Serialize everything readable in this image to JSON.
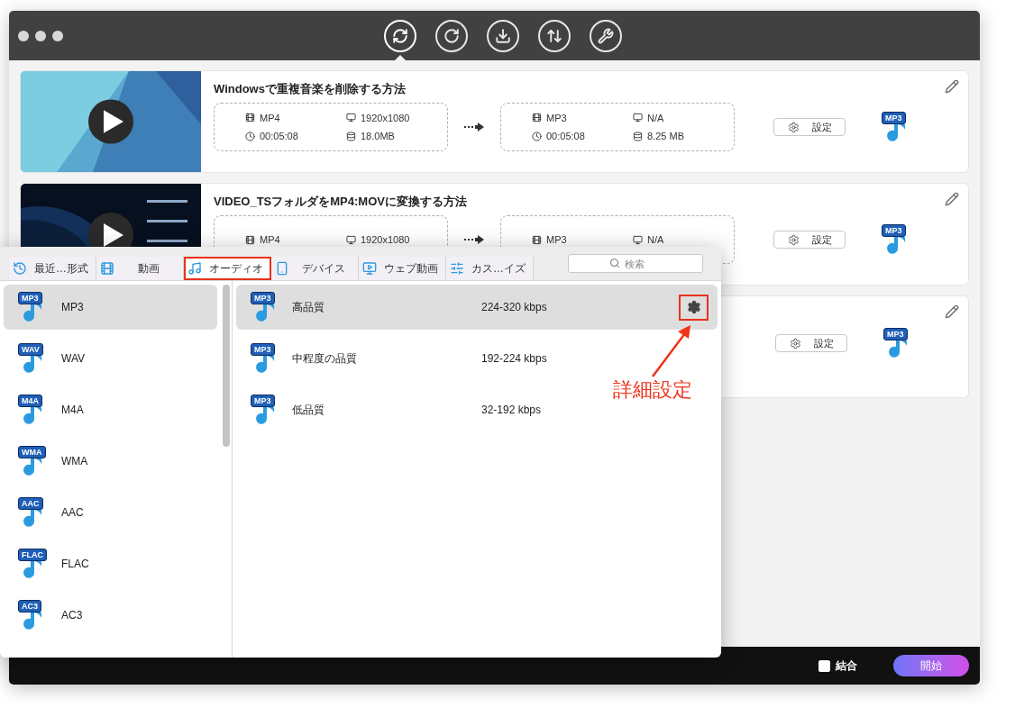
{
  "toolbar_buttons": [
    {
      "selected": true
    },
    {
      "selected": false
    },
    {
      "selected": false
    },
    {
      "selected": false
    },
    {
      "selected": false
    }
  ],
  "tasks": [
    {
      "title": "Windowsで重複音楽を削除する方法",
      "source": {
        "format": "MP4",
        "resolution": "1920x1080",
        "duration": "00:05:08",
        "size": "18.0MB"
      },
      "target": {
        "format": "MP3",
        "resolution": "N/A",
        "duration": "00:05:08",
        "size": "8.25 MB"
      },
      "settings_label": "設定",
      "output_badge": "MP3"
    },
    {
      "title": "VIDEO_TSフォルダをMP4:MOVに変換する方法",
      "source": {
        "format": "MP4",
        "resolution": "1920x1080"
      },
      "target": {
        "format": "MP3",
        "resolution": "N/A"
      },
      "settings_label": "設定",
      "output_badge": "MP3"
    },
    {
      "settings_label": "設定",
      "output_badge": "MP3"
    }
  ],
  "format_panel": {
    "tabs": [
      {
        "label": "最近…形式",
        "kind": "recent",
        "selected": false
      },
      {
        "label": "動画",
        "kind": "video",
        "selected": false
      },
      {
        "label": "オーディオ",
        "kind": "audio",
        "selected": true
      },
      {
        "label": "デバイス",
        "kind": "device",
        "selected": false
      },
      {
        "label": "ウェブ動画",
        "kind": "web",
        "selected": false
      },
      {
        "label": "カス…イズ",
        "kind": "custom",
        "selected": false
      }
    ],
    "search": {
      "placeholder": "検索"
    },
    "formats": [
      {
        "badge": "MP3",
        "name": "MP3",
        "selected": true
      },
      {
        "badge": "WAV",
        "name": "WAV",
        "selected": false
      },
      {
        "badge": "M4A",
        "name": "M4A",
        "selected": false
      },
      {
        "badge": "WMA",
        "name": "WMA",
        "selected": false
      },
      {
        "badge": "AAC",
        "name": "AAC",
        "selected": false
      },
      {
        "badge": "FLAC",
        "name": "FLAC",
        "selected": false
      },
      {
        "badge": "AC3",
        "name": "AC3",
        "selected": false
      }
    ],
    "presets": [
      {
        "badge": "MP3",
        "name": "高品質",
        "bitrate": "224-320 kbps",
        "selected": true
      },
      {
        "badge": "MP3",
        "name": "中程度の品質",
        "bitrate": "192-224 kbps",
        "selected": false
      },
      {
        "badge": "MP3",
        "name": "低品質",
        "bitrate": "32-192 kbps",
        "selected": false
      }
    ]
  },
  "annotation": {
    "text": "詳細設定"
  },
  "bottom_bar": {
    "merge_label": "結合",
    "merge_checked": false,
    "start_label": "開始"
  }
}
